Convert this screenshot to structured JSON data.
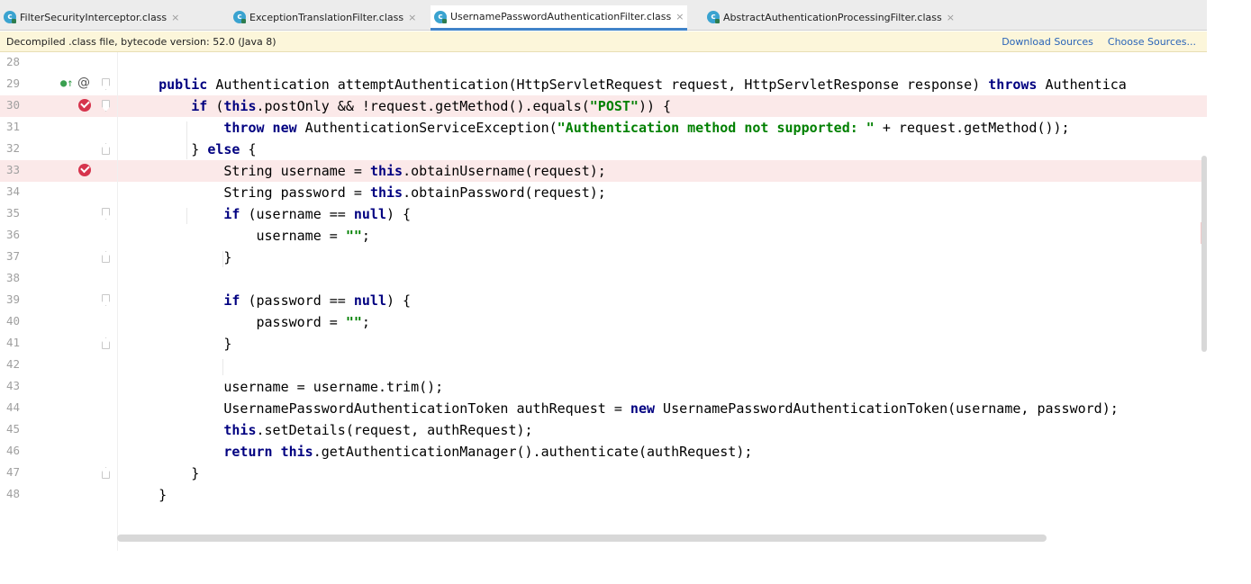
{
  "tabs": [
    {
      "label": "FilterSecurityInterceptor.class",
      "active": false
    },
    {
      "label": "ExceptionTranslationFilter.class",
      "active": false
    },
    {
      "label": "UsernamePasswordAuthenticationFilter.class",
      "active": true
    },
    {
      "label": "AbstractAuthenticationProcessingFilter.class",
      "active": false
    }
  ],
  "tab_icon_letter": "c",
  "close_glyph": "×",
  "banner": {
    "text": "Decompiled .class file, bytecode version: 52.0 (Java 8)",
    "download_sources": "Download Sources",
    "choose_sources": "Choose Sources..."
  },
  "gutter_markers": {
    "annotation": "@"
  },
  "colors": {
    "accent": "#4083c9",
    "breakpoint": "#d6344d",
    "highlight": "#fbe9e9",
    "keyword": "#000080",
    "string": "#008000"
  },
  "lines": [
    {
      "num": "28",
      "tokens": [
        {
          "t": ""
        }
      ]
    },
    {
      "num": "29",
      "tokens": [
        {
          "t": "    "
        },
        {
          "t": "public",
          "c": "kw"
        },
        {
          "t": " Authentication attemptAuthentication(HttpServletRequest request, HttpServletResponse response) "
        },
        {
          "t": "throws",
          "c": "kw"
        },
        {
          "t": " Authentica"
        }
      ]
    },
    {
      "num": "30",
      "tokens": [
        {
          "t": "        "
        },
        {
          "t": "if",
          "c": "kw"
        },
        {
          "t": " ("
        },
        {
          "t": "this",
          "c": "kw"
        },
        {
          "t": ".postOnly && !request.getMethod().equals("
        },
        {
          "t": "\"POST\"",
          "c": "str"
        },
        {
          "t": ")) {"
        }
      ]
    },
    {
      "num": "31",
      "tokens": [
        {
          "t": "            "
        },
        {
          "t": "throw new",
          "c": "kw"
        },
        {
          "t": " AuthenticationServiceException("
        },
        {
          "t": "\"Authentication method not supported: \"",
          "c": "str"
        },
        {
          "t": " + request.getMethod());"
        }
      ]
    },
    {
      "num": "32",
      "tokens": [
        {
          "t": "        } "
        },
        {
          "t": "else",
          "c": "kw"
        },
        {
          "t": " {"
        }
      ]
    },
    {
      "num": "33",
      "tokens": [
        {
          "t": "            String username = "
        },
        {
          "t": "this",
          "c": "kw"
        },
        {
          "t": ".obtainUsername(request);"
        }
      ]
    },
    {
      "num": "34",
      "tokens": [
        {
          "t": "            String password = "
        },
        {
          "t": "this",
          "c": "kw"
        },
        {
          "t": ".obtainPassword(request);"
        }
      ]
    },
    {
      "num": "35",
      "tokens": [
        {
          "t": "            "
        },
        {
          "t": "if",
          "c": "kw"
        },
        {
          "t": " (username == "
        },
        {
          "t": "null",
          "c": "kw"
        },
        {
          "t": ") {"
        }
      ]
    },
    {
      "num": "36",
      "tokens": [
        {
          "t": "                username = "
        },
        {
          "t": "\"\"",
          "c": "str"
        },
        {
          "t": ";"
        }
      ]
    },
    {
      "num": "37",
      "tokens": [
        {
          "t": "            }"
        }
      ]
    },
    {
      "num": "38",
      "tokens": [
        {
          "t": ""
        }
      ]
    },
    {
      "num": "39",
      "tokens": [
        {
          "t": "            "
        },
        {
          "t": "if",
          "c": "kw"
        },
        {
          "t": " (password == "
        },
        {
          "t": "null",
          "c": "kw"
        },
        {
          "t": ") {"
        }
      ]
    },
    {
      "num": "40",
      "tokens": [
        {
          "t": "                password = "
        },
        {
          "t": "\"\"",
          "c": "str"
        },
        {
          "t": ";"
        }
      ]
    },
    {
      "num": "41",
      "tokens": [
        {
          "t": "            }"
        }
      ]
    },
    {
      "num": "42",
      "tokens": [
        {
          "t": ""
        }
      ]
    },
    {
      "num": "43",
      "tokens": [
        {
          "t": "            username = username.trim();"
        }
      ]
    },
    {
      "num": "44",
      "tokens": [
        {
          "t": "            UsernamePasswordAuthenticationToken authRequest = "
        },
        {
          "t": "new",
          "c": "kw"
        },
        {
          "t": " UsernamePasswordAuthenticationToken(username, password);"
        }
      ]
    },
    {
      "num": "45",
      "tokens": [
        {
          "t": "            "
        },
        {
          "t": "this",
          "c": "kw"
        },
        {
          "t": ".setDetails(request, authRequest);"
        }
      ]
    },
    {
      "num": "46",
      "tokens": [
        {
          "t": "            "
        },
        {
          "t": "return this",
          "c": "kw"
        },
        {
          "t": ".getAuthenticationManager().authenticate(authRequest);"
        }
      ]
    },
    {
      "num": "47",
      "tokens": [
        {
          "t": "        }"
        }
      ]
    },
    {
      "num": "48",
      "tokens": [
        {
          "t": "    }"
        }
      ]
    }
  ]
}
